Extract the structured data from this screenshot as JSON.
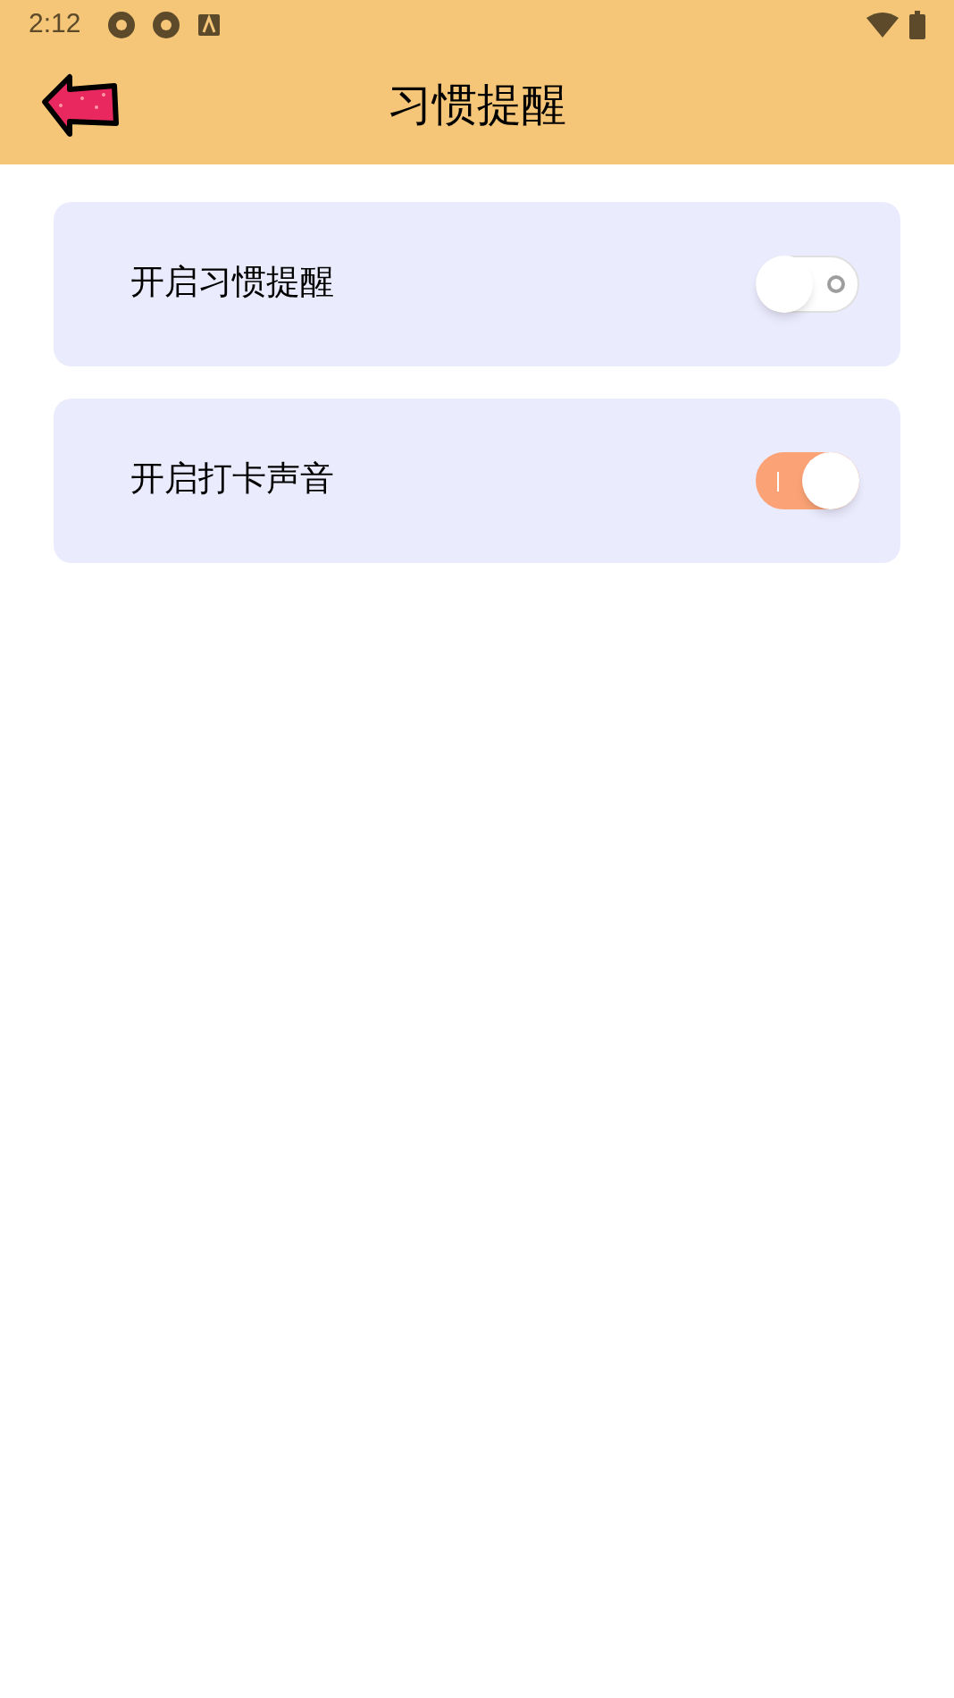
{
  "status_bar": {
    "time": "2:12"
  },
  "header": {
    "title": "习惯提醒"
  },
  "settings": [
    {
      "label": "开启习惯提醒",
      "on": false
    },
    {
      "label": "开启打卡声音",
      "on": true
    }
  ]
}
